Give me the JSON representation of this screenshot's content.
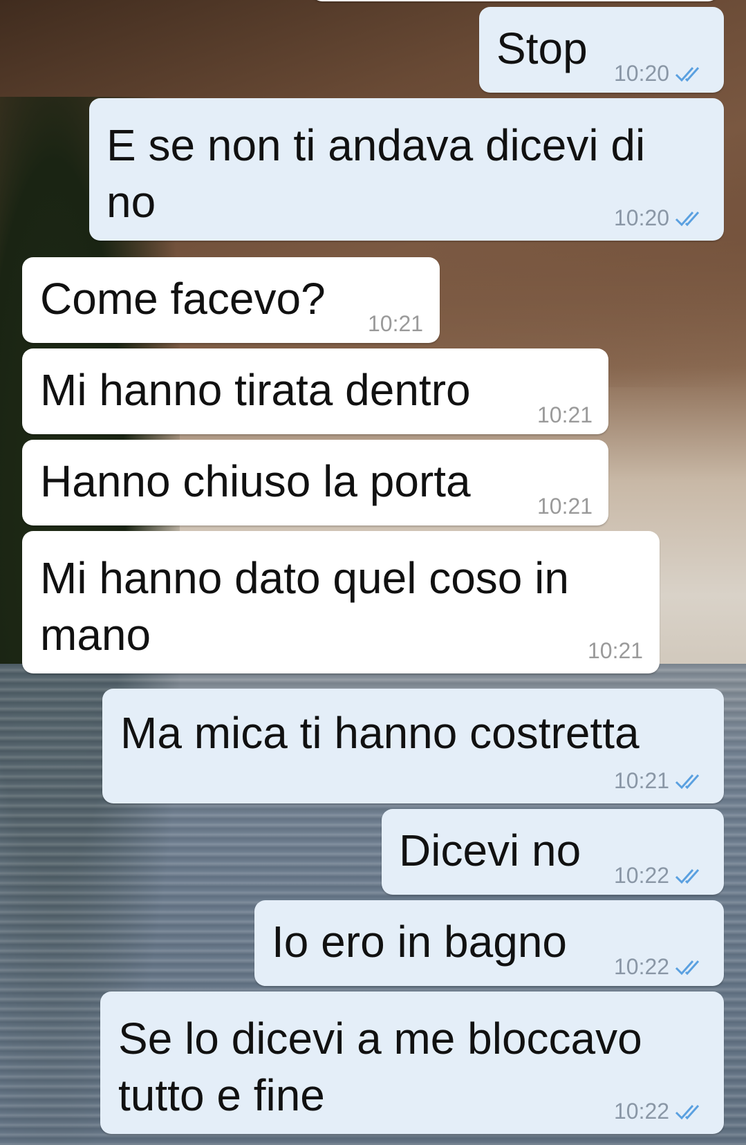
{
  "colors": {
    "outgoing_bubble": "#e4eef8",
    "incoming_bubble": "#ffffff",
    "read_check": "#5aa0e0",
    "time_outgoing": "#8a97a6",
    "time_incoming": "#9a9a9a"
  },
  "messages": [
    {
      "direction": "out",
      "lines": [
        "Stop"
      ],
      "time": "10:20",
      "status": "read-double-check-icon"
    },
    {
      "direction": "out",
      "lines": [
        "E se non ti andava dicevi di",
        "no"
      ],
      "time": "10:20",
      "status": "read-double-check-icon"
    },
    {
      "direction": "in",
      "lines": [
        "Come facevo?"
      ],
      "time": "10:21"
    },
    {
      "direction": "in",
      "lines": [
        "Mi hanno tirata dentro"
      ],
      "time": "10:21"
    },
    {
      "direction": "in",
      "lines": [
        "Hanno chiuso la porta"
      ],
      "time": "10:21"
    },
    {
      "direction": "in",
      "lines": [
        "Mi hanno dato quel coso in",
        "mano"
      ],
      "time": "10:21"
    },
    {
      "direction": "out",
      "lines": [
        "Ma mica ti hanno costretta"
      ],
      "time": "10:21",
      "status": "read-double-check-icon"
    },
    {
      "direction": "out",
      "lines": [
        "Dicevi no"
      ],
      "time": "10:22",
      "status": "read-double-check-icon"
    },
    {
      "direction": "out",
      "lines": [
        "Io ero in bagno"
      ],
      "time": "10:22",
      "status": "read-double-check-icon"
    },
    {
      "direction": "out",
      "lines": [
        "Se lo dicevi a me bloccavo",
        "tutto e fine"
      ],
      "time": "10:22",
      "status": "read-double-check-icon"
    }
  ]
}
